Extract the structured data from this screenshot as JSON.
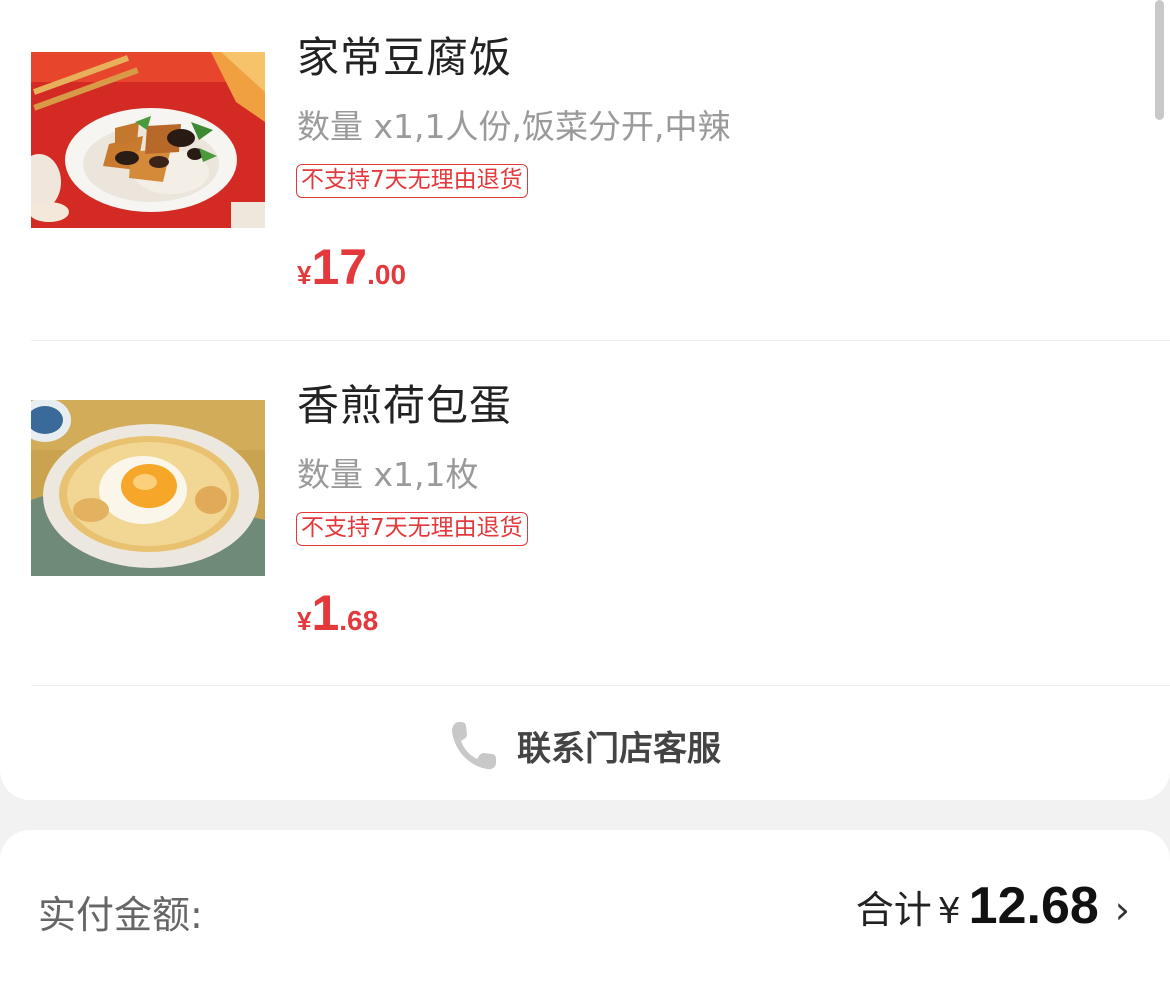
{
  "order_items": [
    {
      "name": "家常豆腐饭",
      "spec": "数量 x1,1人份,饭菜分开,中辣",
      "badge": "不支持7天无理由退货",
      "price_symbol": "¥",
      "price_int": "17",
      "price_dec": ".00",
      "image": "tofu-rice-dish-image"
    },
    {
      "name": "香煎荷包蛋",
      "spec": "数量 x1,1枚",
      "badge": "不支持7天无理由退货",
      "price_symbol": "¥",
      "price_int": "1",
      "price_dec": ".68",
      "image": "fried-egg-image"
    }
  ],
  "contact": {
    "label": "联系门店客服",
    "icon": "phone-icon"
  },
  "payment": {
    "label": "实付金额:",
    "total_label": "合计",
    "currency": "¥",
    "total_value": "12.68",
    "chevron": "›"
  },
  "colors": {
    "accent_red": "#e4393c",
    "text_dark": "#222222",
    "text_gray": "#9a9a9a",
    "background": "#f2f2f2"
  }
}
